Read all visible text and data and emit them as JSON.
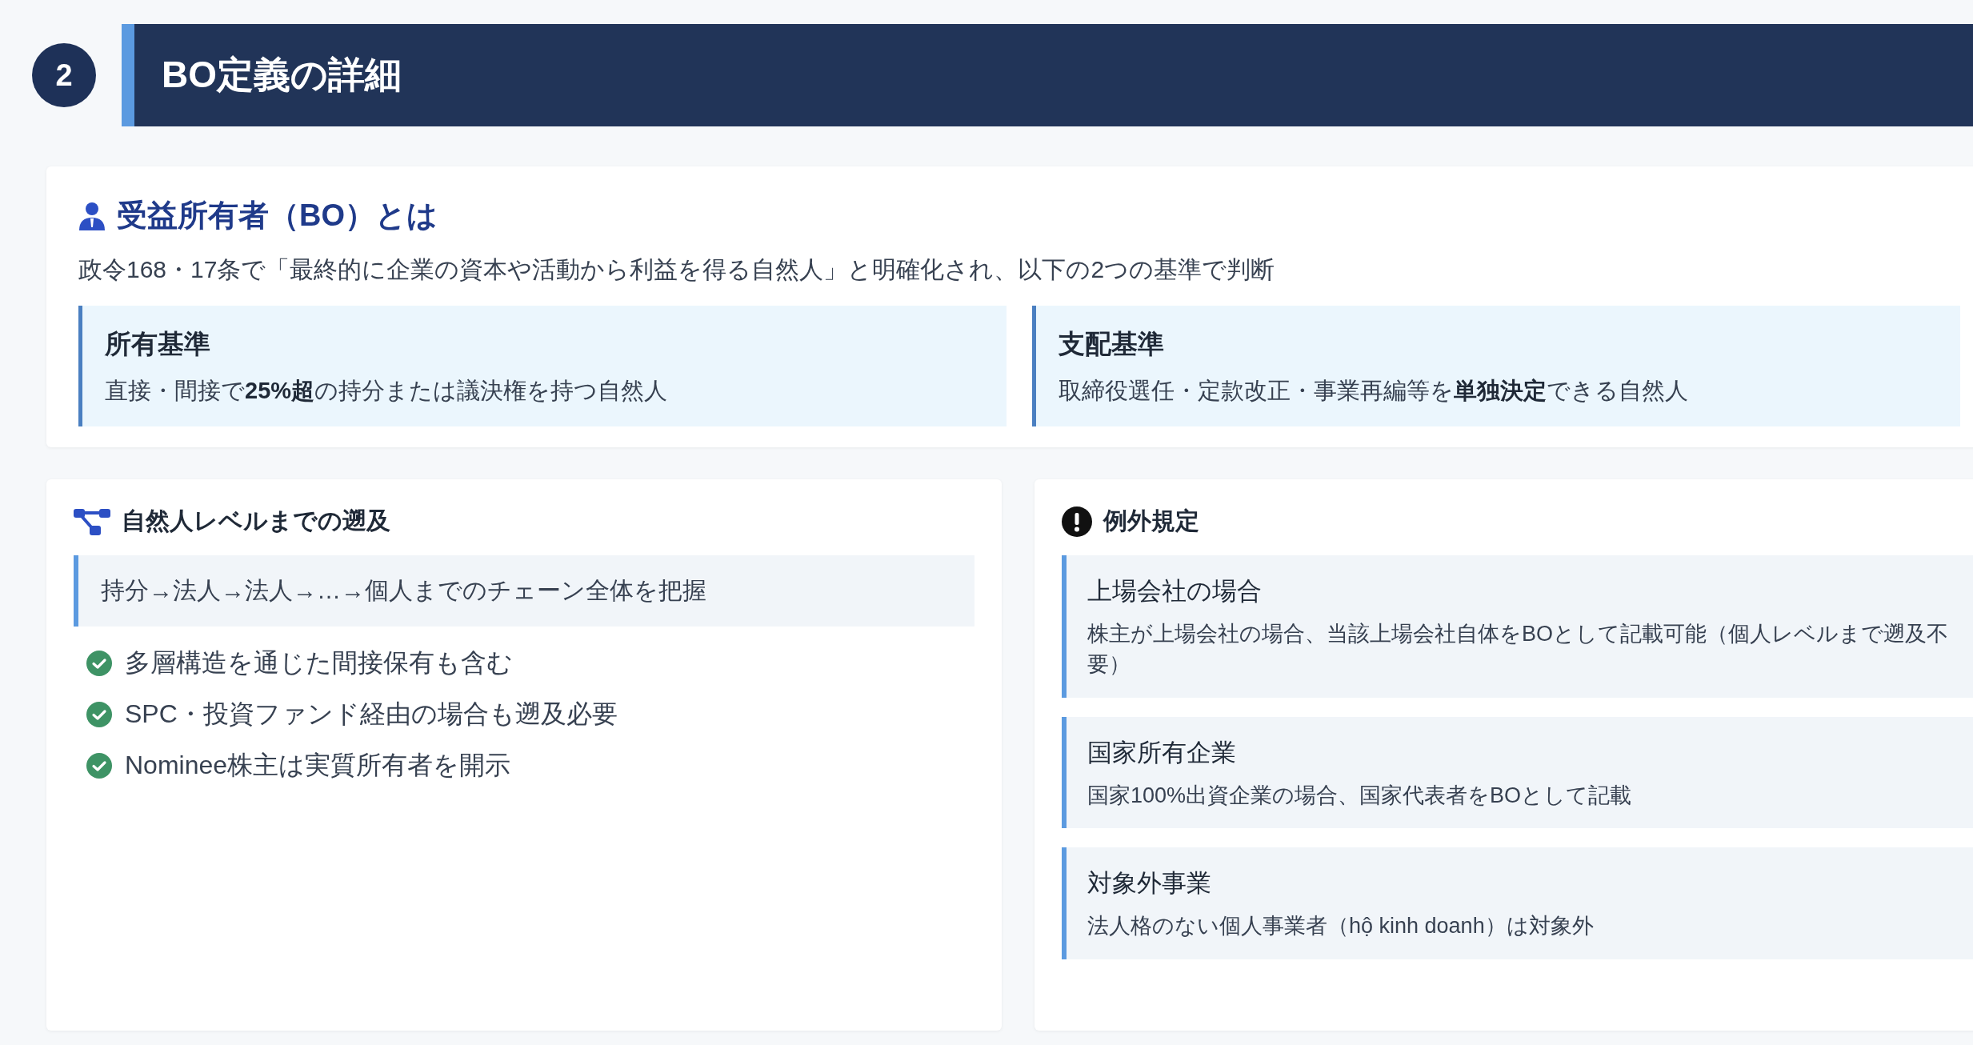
{
  "section": {
    "number": "2",
    "title": "BO定義の詳細"
  },
  "definition": {
    "title": "受益所有者（BO）とは",
    "description": "政令168・17条で「最終的に企業の資本や活動から利益を得る自然人」と明確化され、以下の2つの基準で判断",
    "criteria": [
      {
        "title": "所有基準",
        "text": "直接・間接で**25%超**の持分または議決権を持つ自然人"
      },
      {
        "title": "支配基準",
        "text": "取締役選任・定款改正・事業再編等を**単独決定**できる自然人"
      }
    ]
  },
  "tracing": {
    "title": "自然人レベルまでの遡及",
    "callout": "持分→法人→法人→…→個人までのチェーン全体を把握",
    "points": [
      "多層構造を通じた間接保有も含む",
      "SPC・投資ファンド経由の場合も遡及必要",
      "Nominee株主は実質所有者を開示"
    ]
  },
  "exceptions": {
    "title": "例外規定",
    "items": [
      {
        "title": "上場会社の場合",
        "text": "株主が上場会社の場合、当該上場会社自体をBOとして記載可能（個人レベルまで遡及不要）"
      },
      {
        "title": "国家所有企業",
        "text": "国家100%出資企業の場合、国家代表者をBOとして記載"
      },
      {
        "title": "対象外事業",
        "text": "法人格のない個人事業者（hộ kinh doanh）は対象外"
      }
    ]
  }
}
